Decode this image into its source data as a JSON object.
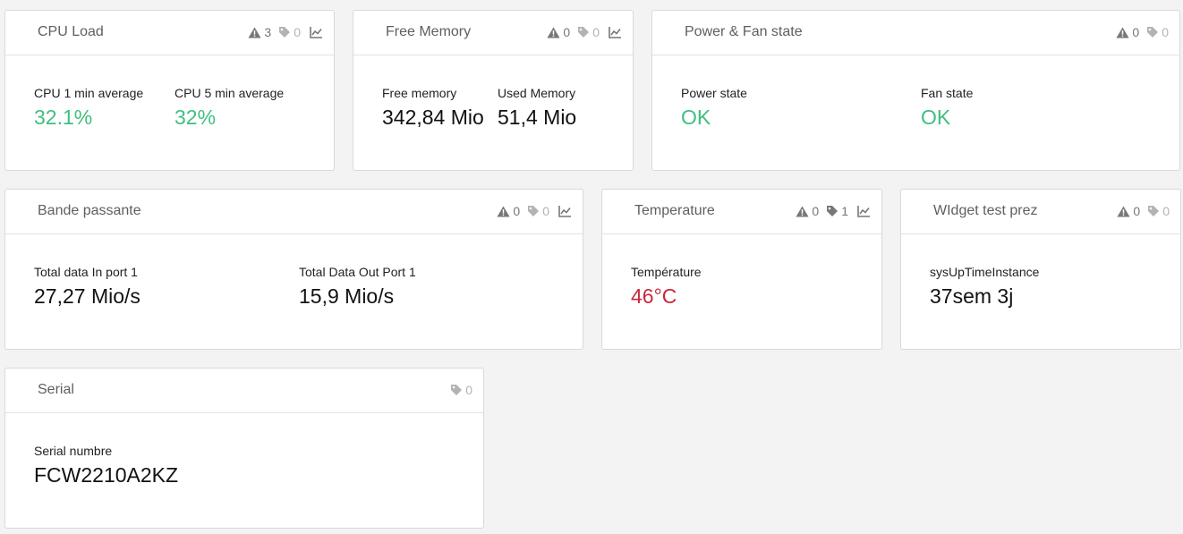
{
  "colors": {
    "ok": "#3fbf7f",
    "alert": "#c8273d",
    "icon": "#777777",
    "icon_muted": "#b3b3b3"
  },
  "icons": {
    "alerts": "warning-triangle-icon",
    "tags": "tag-icon",
    "chart": "line-chart-icon"
  },
  "widgets": {
    "cpu": {
      "title": "CPU Load",
      "alerts": "3",
      "tags": "0",
      "metrics": [
        {
          "label": "CPU 1 min average",
          "value": "32.1%"
        },
        {
          "label": "CPU 5 min average",
          "value": "32%"
        }
      ]
    },
    "memory": {
      "title": "Free Memory",
      "alerts": "0",
      "tags": "0",
      "metrics": [
        {
          "label": "Free memory",
          "value": "342,84 Mio"
        },
        {
          "label": "Used Memory",
          "value": "51,4 Mio"
        }
      ]
    },
    "power": {
      "title": "Power & Fan state",
      "alerts": "0",
      "tags": "0",
      "metrics": [
        {
          "label": "Power state",
          "value": "OK"
        },
        {
          "label": "Fan state",
          "value": "OK"
        }
      ]
    },
    "bandwidth": {
      "title": "Bande passante",
      "alerts": "0",
      "tags": "0",
      "metrics": [
        {
          "label": "Total data In port 1",
          "value": "27,27 Mio/s"
        },
        {
          "label": "Total Data Out Port 1",
          "value": "15,9 Mio/s"
        }
      ]
    },
    "temperature": {
      "title": "Temperature",
      "alerts": "0",
      "tags": "1",
      "metrics": [
        {
          "label": "Température",
          "value": "46°C"
        }
      ]
    },
    "widgettest": {
      "title": "WIdget test prez",
      "alerts": "0",
      "tags": "0",
      "metrics": [
        {
          "label": "sysUpTimeInstance",
          "value": "37sem 3j"
        }
      ]
    },
    "serial": {
      "title": "Serial",
      "tags": "0",
      "metrics": [
        {
          "label": "Serial numbre",
          "value": "FCW2210A2KZ"
        }
      ]
    }
  }
}
